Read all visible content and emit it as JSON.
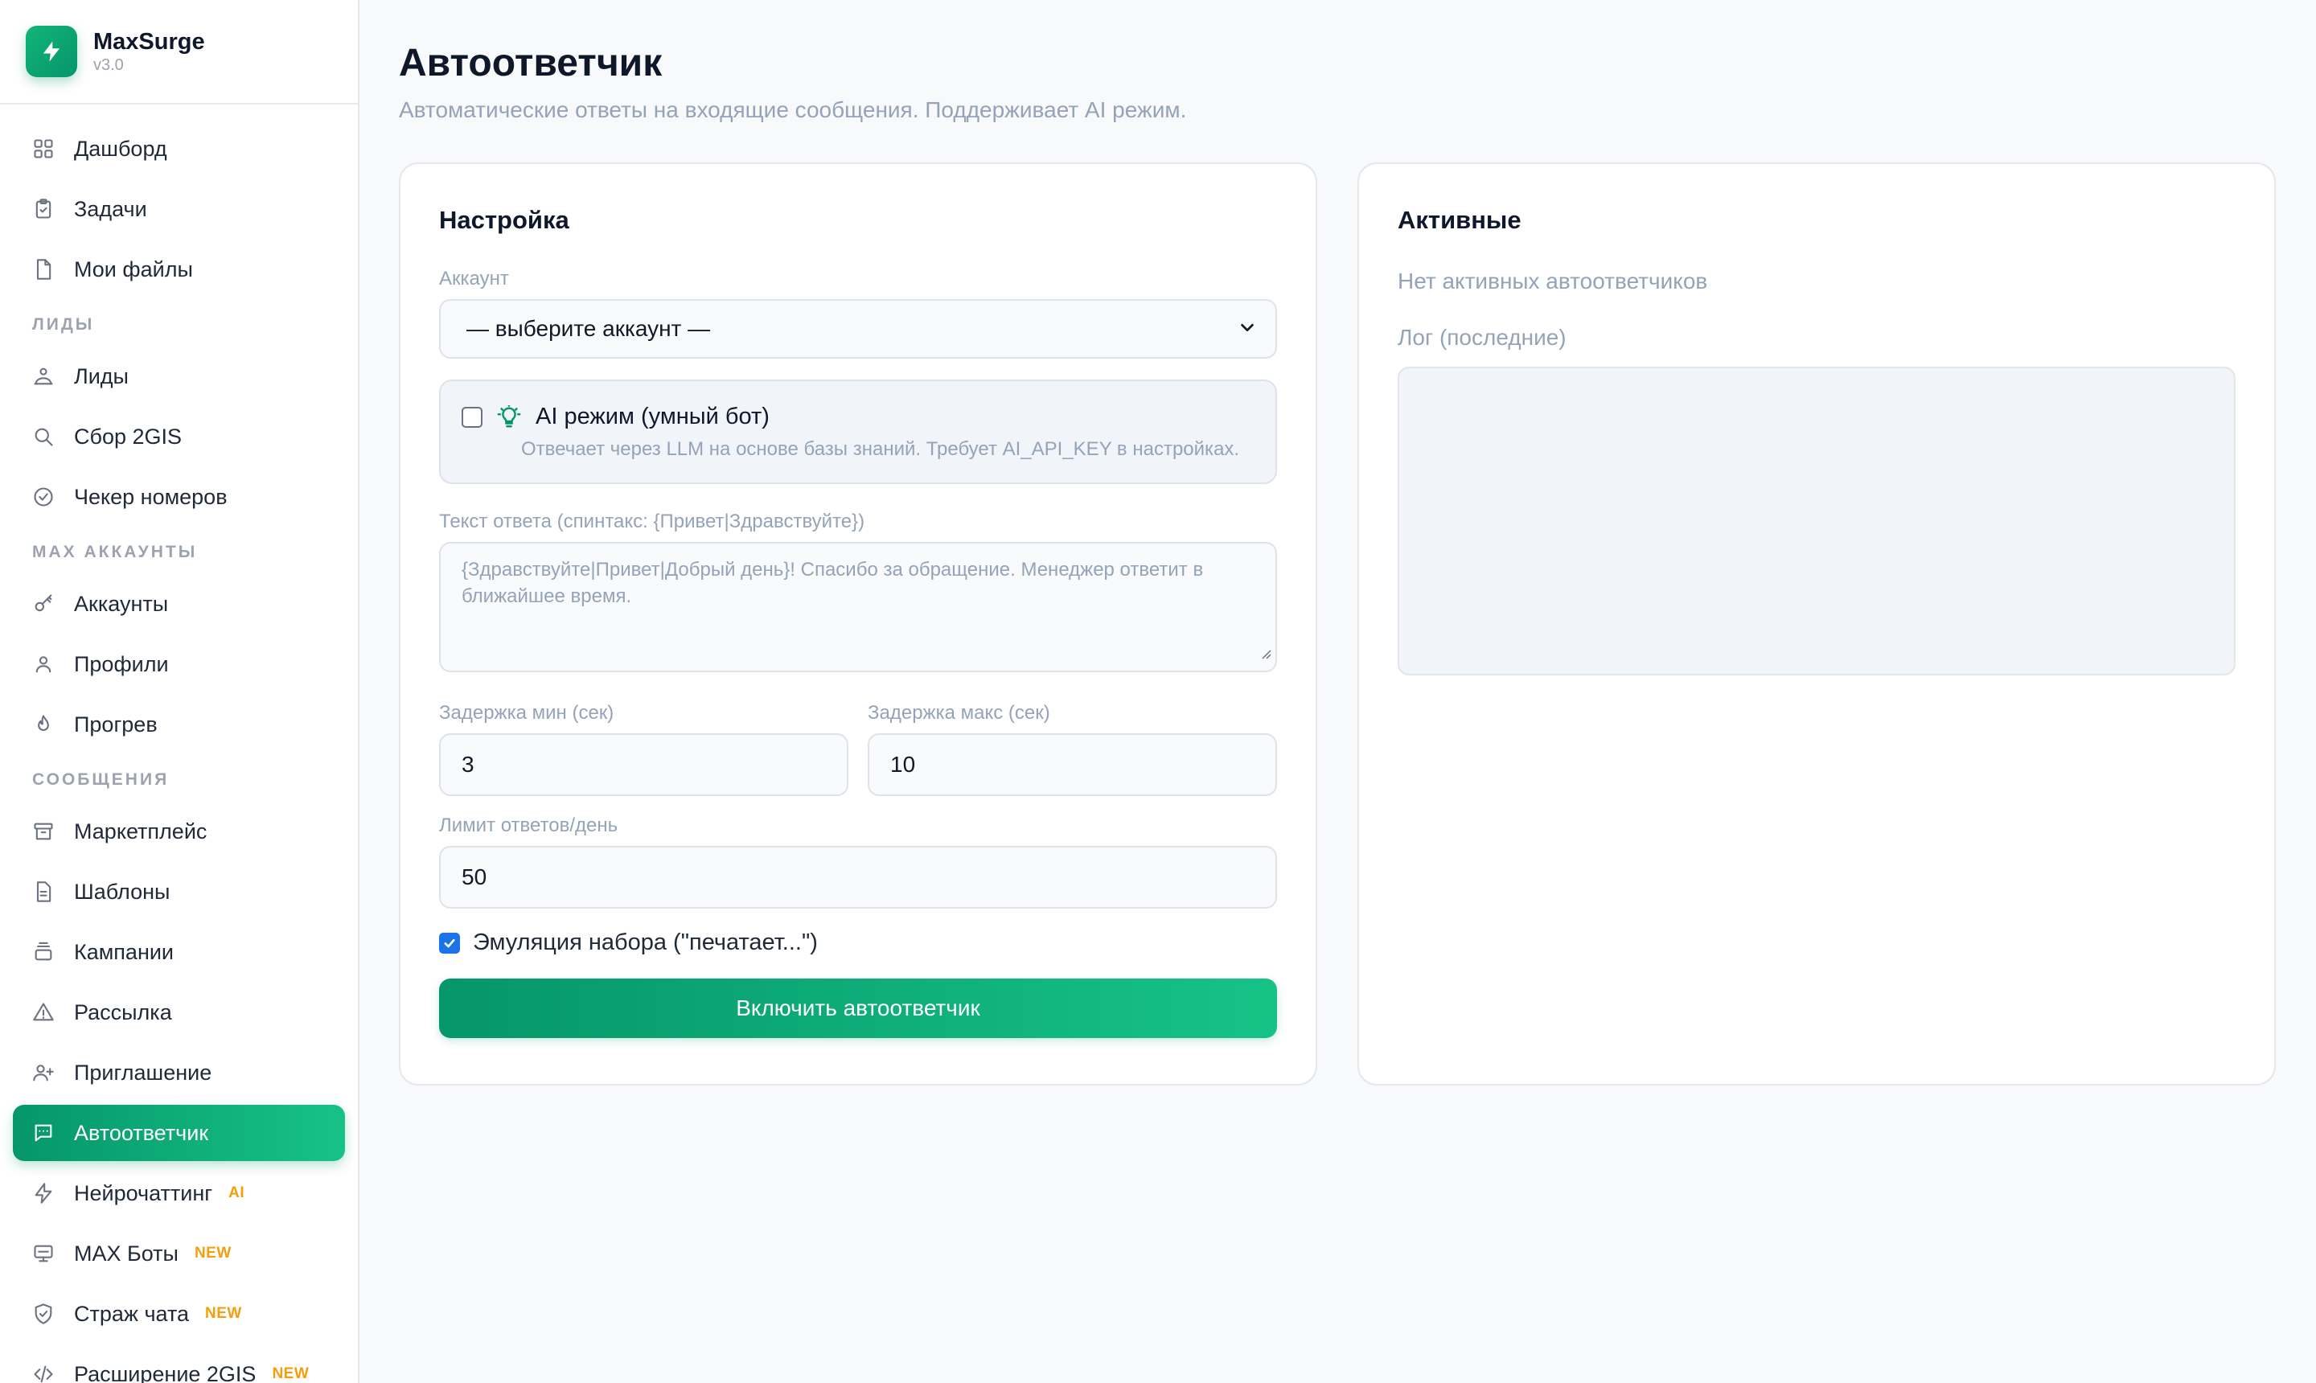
{
  "brand": {
    "name": "MaxSurge",
    "version": "v3.0"
  },
  "sidebar": {
    "items": [
      {
        "type": "item",
        "label": "Дашборд",
        "icon": "grid-icon"
      },
      {
        "type": "item",
        "label": "Задачи",
        "icon": "clipboard-icon"
      },
      {
        "type": "item",
        "label": "Мои файлы",
        "icon": "file-icon"
      },
      {
        "type": "section",
        "label": "ЛИДЫ"
      },
      {
        "type": "item",
        "label": "Лиды",
        "icon": "users-icon"
      },
      {
        "type": "item",
        "label": "Сбор 2GIS",
        "icon": "search-icon"
      },
      {
        "type": "item",
        "label": "Чекер номеров",
        "icon": "check-circle-icon"
      },
      {
        "type": "section",
        "label": "MAX АККАУНТЫ"
      },
      {
        "type": "item",
        "label": "Аккаунты",
        "icon": "key-icon"
      },
      {
        "type": "item",
        "label": "Профили",
        "icon": "user-icon"
      },
      {
        "type": "item",
        "label": "Прогрев",
        "icon": "flame-icon"
      },
      {
        "type": "section",
        "label": "СООБЩЕНИЯ"
      },
      {
        "type": "item",
        "label": "Маркетплейс",
        "icon": "archive-icon"
      },
      {
        "type": "item",
        "label": "Шаблоны",
        "icon": "document-icon"
      },
      {
        "type": "item",
        "label": "Кампании",
        "icon": "layers-icon"
      },
      {
        "type": "item",
        "label": "Рассылка",
        "icon": "alert-triangle-icon"
      },
      {
        "type": "item",
        "label": "Приглашение",
        "icon": "user-plus-icon"
      },
      {
        "type": "item",
        "label": "Автоответчик",
        "icon": "chat-icon",
        "active": true
      },
      {
        "type": "item",
        "label": "Нейрочаттинг",
        "icon": "bolt-icon",
        "badge": "AI"
      },
      {
        "type": "item",
        "label": "MAX Боты",
        "icon": "monitor-icon",
        "badge": "NEW"
      },
      {
        "type": "item",
        "label": "Страж чата",
        "icon": "shield-icon",
        "badge": "NEW"
      },
      {
        "type": "item",
        "label": "Расширение 2GIS",
        "icon": "code-icon",
        "badge": "NEW"
      }
    ]
  },
  "page": {
    "title": "Автоответчик",
    "subtitle": "Автоматические ответы на входящие сообщения. Поддерживает AI режим."
  },
  "settings": {
    "title": "Настройка",
    "account_label": "Аккаунт",
    "account_value": "— выберите аккаунт —",
    "ai_title": "AI режим (умный бот)",
    "ai_desc": "Отвечает через LLM на основе базы знаний. Требует AI_API_KEY в настройках.",
    "ai_checked": false,
    "reply_label": "Текст ответа (спинтакс: {Привет|Здравствуйте})",
    "reply_placeholder": "{Здравствуйте|Привет|Добрый день}! Спасибо за обращение. Менеджер ответит в ближайшее время.",
    "delay_min_label": "Задержка мин (сек)",
    "delay_min_value": "3",
    "delay_max_label": "Задержка макс (сек)",
    "delay_max_value": "10",
    "limit_label": "Лимит ответов/день",
    "limit_value": "50",
    "typing_label": "Эмуляция набора (\"печатает...\")",
    "typing_checked": true,
    "submit_label": "Включить автоответчик"
  },
  "active": {
    "title": "Активные",
    "empty_text": "Нет активных автоответчиков",
    "log_label": "Лог (последние)"
  },
  "colors": {
    "accent": "#059669",
    "accent_light": "#17c287",
    "badge": "#f59e0b"
  }
}
